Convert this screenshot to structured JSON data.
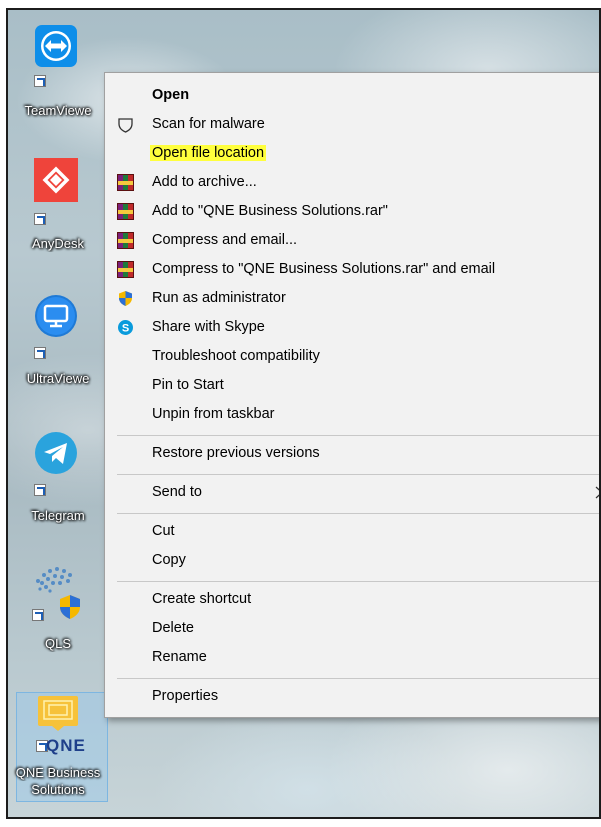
{
  "desktop": {
    "icons": [
      {
        "label": "TeamViewe"
      },
      {
        "label": "AnyDesk"
      },
      {
        "label": "UltraViewe"
      },
      {
        "label": "Telegram"
      },
      {
        "label": "QLS"
      },
      {
        "label": "QNE Business Solutions",
        "label_line1": "QNE Business",
        "label_line2": "Solutions",
        "logo_text": "QNE"
      }
    ]
  },
  "context_menu": {
    "items": [
      {
        "label": "Open",
        "bold": true,
        "icon": ""
      },
      {
        "label": "Scan for malware",
        "icon": "shield-outline-icon"
      },
      {
        "label": "Open file location",
        "icon": "",
        "highlighted": true
      },
      {
        "label": "Add to archive...",
        "icon": "winrar-icon"
      },
      {
        "label": "Add to \"QNE Business Solutions.rar\"",
        "icon": "winrar-icon"
      },
      {
        "label": "Compress and email...",
        "icon": "winrar-icon"
      },
      {
        "label": "Compress to \"QNE Business Solutions.rar\" and email",
        "icon": "winrar-icon"
      },
      {
        "label": "Run as administrator",
        "icon": "uac-shield-icon"
      },
      {
        "label": "Share with Skype",
        "icon": "skype-icon"
      },
      {
        "label": "Troubleshoot compatibility",
        "icon": ""
      },
      {
        "label": "Pin to Start",
        "icon": ""
      },
      {
        "label": "Unpin from taskbar",
        "icon": ""
      },
      {
        "label": "Restore previous versions",
        "icon": ""
      },
      {
        "label": "Send to",
        "icon": "",
        "submenu": true
      },
      {
        "label": "Cut",
        "icon": ""
      },
      {
        "label": "Copy",
        "icon": ""
      },
      {
        "label": "Create shortcut",
        "icon": ""
      },
      {
        "label": "Delete",
        "icon": ""
      },
      {
        "label": "Rename",
        "icon": ""
      },
      {
        "label": "Properties",
        "icon": ""
      }
    ],
    "highlight_color": "#ffff3d"
  }
}
